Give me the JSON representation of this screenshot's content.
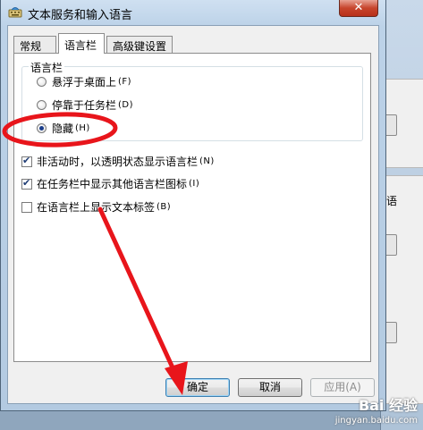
{
  "window": {
    "title": "文本服务和输入语言",
    "close_label": "✕"
  },
  "tabs": [
    {
      "label": "常规",
      "active": false
    },
    {
      "label": "语言栏",
      "active": true
    },
    {
      "label": "高级键设置",
      "active": false
    }
  ],
  "language_bar": {
    "group_label": "语言栏",
    "options": [
      {
        "label": "悬浮于桌面上",
        "shortcut": "(F)",
        "checked": false
      },
      {
        "label": "停靠于任务栏",
        "shortcut": "(D)",
        "checked": false
      },
      {
        "label": "隐藏",
        "shortcut": "(H)",
        "checked": true
      }
    ],
    "checkboxes": [
      {
        "label": "非活动时，以透明状态显示语言栏",
        "shortcut": "(N)",
        "checked": true
      },
      {
        "label": "在任务栏中显示其他语言栏图标",
        "shortcut": "(I)",
        "checked": true
      },
      {
        "label": "在语言栏上显示文本标签",
        "shortcut": "(B)",
        "checked": false
      }
    ]
  },
  "buttons": {
    "ok": "确定",
    "cancel": "取消",
    "apply": "应用(A)"
  },
  "background_window": {
    "partial_char": "语"
  },
  "watermark": {
    "brand": "Bai 经验",
    "url": "jingyan.baidu.com"
  },
  "colors": {
    "annotation_red": "#e8151b",
    "title_gradient_top": "#cfe0f1",
    "close_button": "#c7452c"
  }
}
